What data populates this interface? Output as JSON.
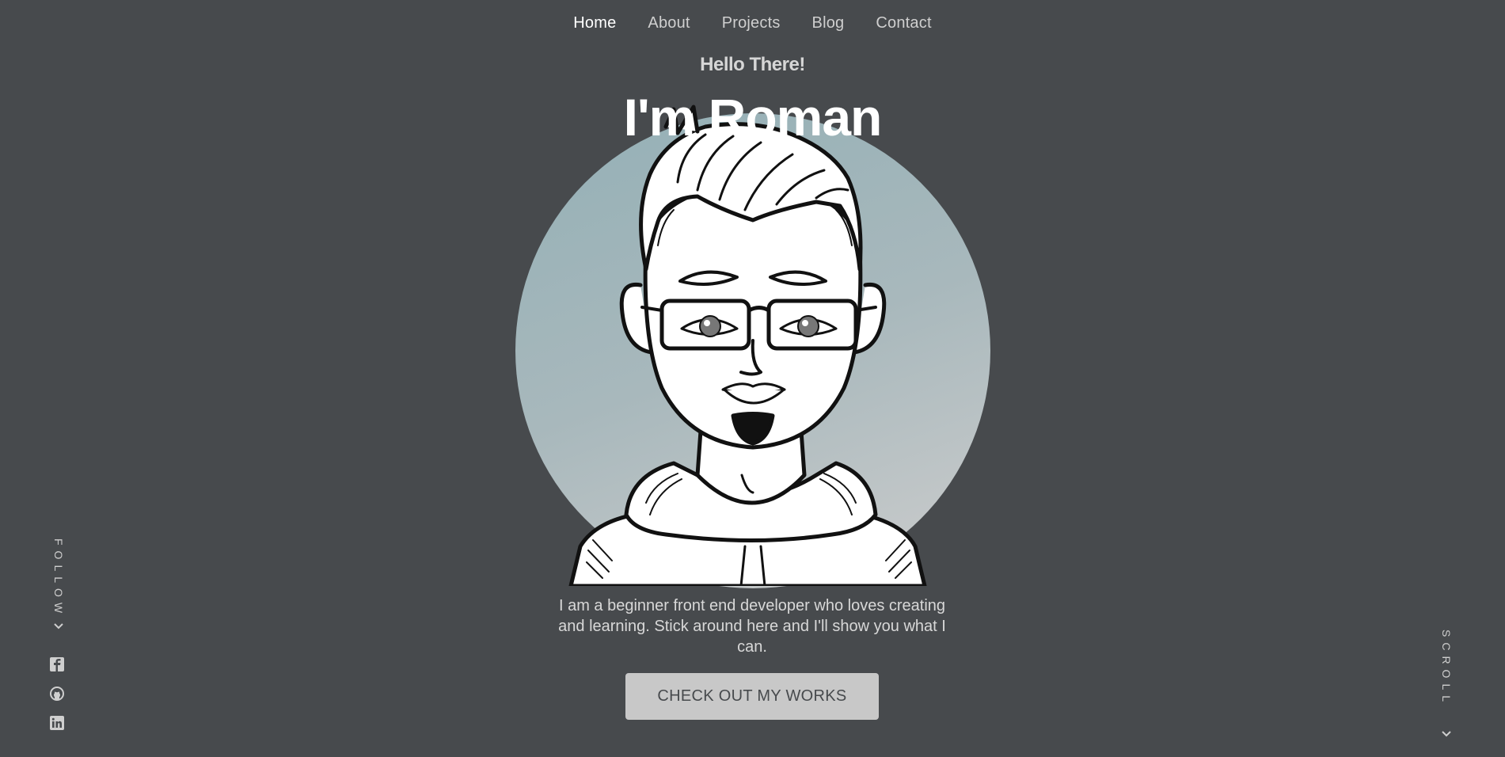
{
  "nav": {
    "items": [
      {
        "label": "Home",
        "active": true
      },
      {
        "label": "About",
        "active": false
      },
      {
        "label": "Projects",
        "active": false
      },
      {
        "label": "Blog",
        "active": false
      },
      {
        "label": "Contact",
        "active": false
      }
    ]
  },
  "hero": {
    "greeting": "Hello There!",
    "headline": "I'm Roman",
    "intro": "I am a beginner front end developer who loves creating and learning. Stick around here and I'll show you what I can.",
    "cta_label": "CHECK OUT MY WORKS"
  },
  "sidebar": {
    "follow_label": "FOLLOW",
    "social": [
      {
        "icon": "facebook-icon"
      },
      {
        "icon": "github-icon"
      },
      {
        "icon": "linkedin-icon"
      }
    ]
  },
  "scroll_label": "SCROLL",
  "colors": {
    "background": "#474a4d",
    "circle_top": "#94b0b6",
    "circle_bottom": "#cdcdcd",
    "button": "#c8c8c8",
    "text_light": "#d8d8d8"
  }
}
